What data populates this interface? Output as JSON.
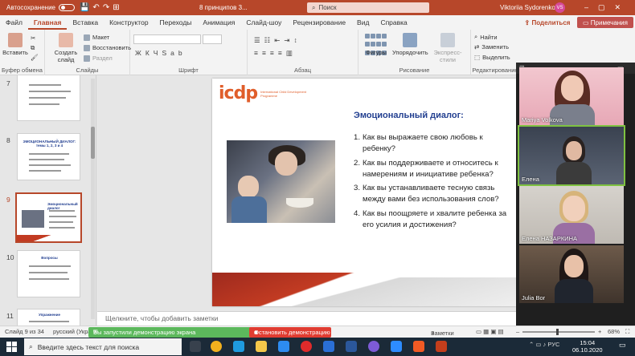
{
  "titlebar": {
    "autosave_label": "Автосохранение",
    "doc_title": "8 принципов 3...",
    "search_placeholder": "Поиск",
    "user_name": "Viktoriia Sydorenko",
    "user_initials": "VS",
    "accent": "#b7472a"
  },
  "menu": {
    "tabs": [
      "Файл",
      "Главная",
      "Вставка",
      "Конструктор",
      "Переходы",
      "Анимация",
      "Слайд-шоу",
      "Рецензирование",
      "Вид",
      "Справка"
    ],
    "active_tab": "Главная",
    "share_label": "Поделиться",
    "comments_label": "Примечания"
  },
  "ribbon": {
    "clipboard": {
      "paste": "Вставить",
      "group": "Буфер обмена"
    },
    "slides": {
      "new_slide": "Создать слайд",
      "layout": "Макет",
      "reset": "Восстановить",
      "section": "Раздел",
      "group": "Слайды"
    },
    "font": {
      "group": "Шрифт"
    },
    "paragraph": {
      "group": "Абзац"
    },
    "drawing": {
      "shapes": "Фигуры",
      "arrange": "Упорядочить",
      "quick_styles": "Экспресс-стили",
      "group": "Рисование"
    },
    "editing": {
      "find": "Найти",
      "replace": "Заменить",
      "select": "Выделить",
      "group": "Редактирование"
    }
  },
  "thumbnails": [
    {
      "num": "7",
      "title": ""
    },
    {
      "num": "8",
      "title": "ЭМОЦИОНАЛЬНЫЙ ДИАЛОГ: темы 1, 2, 3 и 4"
    },
    {
      "num": "9",
      "title": "Эмоциональный диалог"
    },
    {
      "num": "10",
      "title": "Вопросы"
    },
    {
      "num": "11",
      "title": "Упражнение"
    }
  ],
  "slide": {
    "logo_text": "icdp",
    "logo_sub": "International Child Development Programme",
    "heading": "Эмоциональный диалог:",
    "items": [
      {
        "num": "1.",
        "text": "Как вы выражаете свою любовь к ребенку?"
      },
      {
        "num": "2.",
        "text": "Как вы поддерживаете и относитесь к намерениям и инициативе ребенка?"
      },
      {
        "num": "3.",
        "text": "Как вы устанавливаете тесную связь между вами без использования слов?"
      },
      {
        "num": "4.",
        "text": "Как вы поощряете и хвалите ребенка за его усилия и достижения?"
      }
    ]
  },
  "notes_placeholder": "Щелкните, чтобы добавить заметки",
  "video": {
    "participants": [
      {
        "name": "Mariya Volkova"
      },
      {
        "name": "Елена"
      },
      {
        "name": "Елена НАЗАРКИНА"
      },
      {
        "name": "Julia Bor"
      }
    ],
    "active_color": "#7fc241"
  },
  "status": {
    "slide_info": "Слайд 9 из 34",
    "language": "русский (Украи",
    "sharing_text": "Вы запустили демонстрацию экрана",
    "stop_label": "Остановить демонстрацию",
    "notes_label": "Заметки",
    "zoom": "68%"
  },
  "taskbar": {
    "search_placeholder": "Введите здесь текст для поиска",
    "lang": "РУС",
    "time": "15:04",
    "date": "06.10.2020"
  }
}
